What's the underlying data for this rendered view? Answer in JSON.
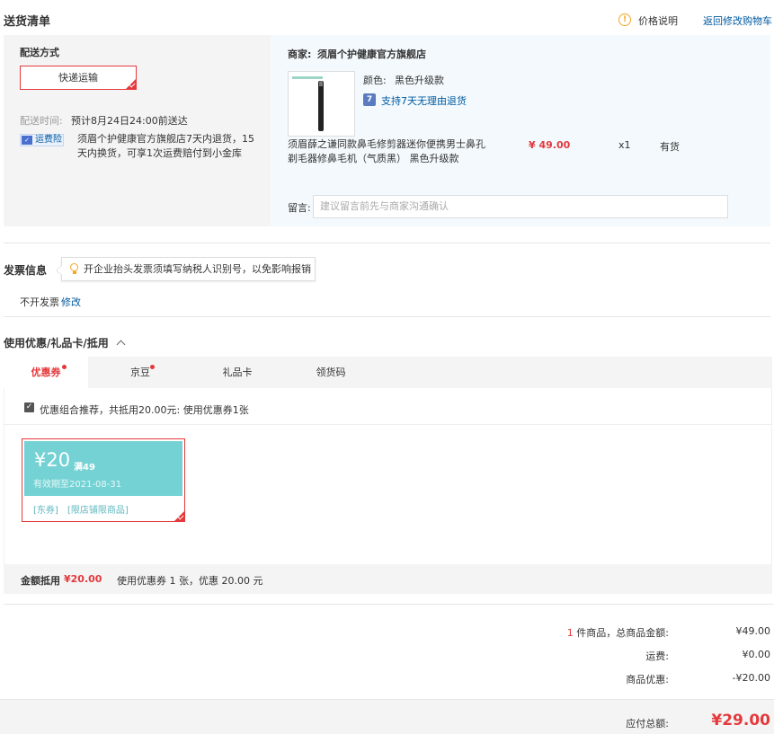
{
  "delivery": {
    "title": "送货清单",
    "price_note_label": "价格说明",
    "back_to_cart_label": "返回修改购物车",
    "method_label": "配送方式",
    "method_value": "快递运输",
    "time_label": "配送时间:",
    "time_value": "预计8月24日24:00前送达",
    "insurance_badge": "运费险",
    "insurance_text": "须眉个护健康官方旗舰店7天内退货，15天内换货，可享1次运费赔付到小金库"
  },
  "shop": {
    "merchant_label": "商家:",
    "merchant_name": "须眉个护健康官方旗舰店",
    "color_label": "颜色:",
    "color_value": "黑色升级款",
    "return_badge": "7",
    "return_text": "支持7天无理由退货",
    "product_name": "须眉薛之谦同款鼻毛修剪器迷你便携男士鼻孔剃毛器修鼻毛机（气质黑） 黑色升级款",
    "price": "¥ 49.00",
    "quantity": "x1",
    "stock": "有货",
    "message_label": "留言:",
    "message_placeholder": "建议留言前先与商家沟通确认"
  },
  "invoice": {
    "title": "发票信息",
    "tip": "开企业抬头发票须填写纳税人识别号，以免影响报销",
    "value": "不开发票",
    "edit_label": "修改"
  },
  "discount": {
    "title": "使用优惠/礼品卡/抵用",
    "tabs": [
      {
        "label": "优惠券",
        "active": true,
        "dot": true
      },
      {
        "label": "京豆",
        "active": false,
        "dot": true
      },
      {
        "label": "礼品卡",
        "active": false,
        "dot": false
      },
      {
        "label": "领货码",
        "active": false,
        "dot": false
      }
    ],
    "recommend_text": "优惠组合推荐，共抵用20.00元: 使用优惠券1张",
    "coupon": {
      "amount": "¥20",
      "condition": "满49",
      "validity": "有效期至2021-08-31",
      "tag1": "[东券]",
      "tag2": "[限店铺限商品]"
    },
    "summary_label": "金额抵用",
    "summary_amount": "¥20.00",
    "summary_detail": "使用优惠券 1 张，优惠 20.00 元"
  },
  "totals": {
    "item_count": "1",
    "items_label": "件商品，总商品金额:",
    "items_amount": "¥49.00",
    "shipping_label": "运费:",
    "shipping_amount": "¥0.00",
    "discount_label": "商品优惠:",
    "discount_amount": "-¥20.00",
    "payable_label": "应付总额:",
    "payable_amount": "¥29.00"
  },
  "colors": {
    "accent_red": "#e4393c",
    "link_blue": "#005aa0",
    "coupon_teal": "#74d2d4",
    "info_orange": "#f5a623"
  }
}
